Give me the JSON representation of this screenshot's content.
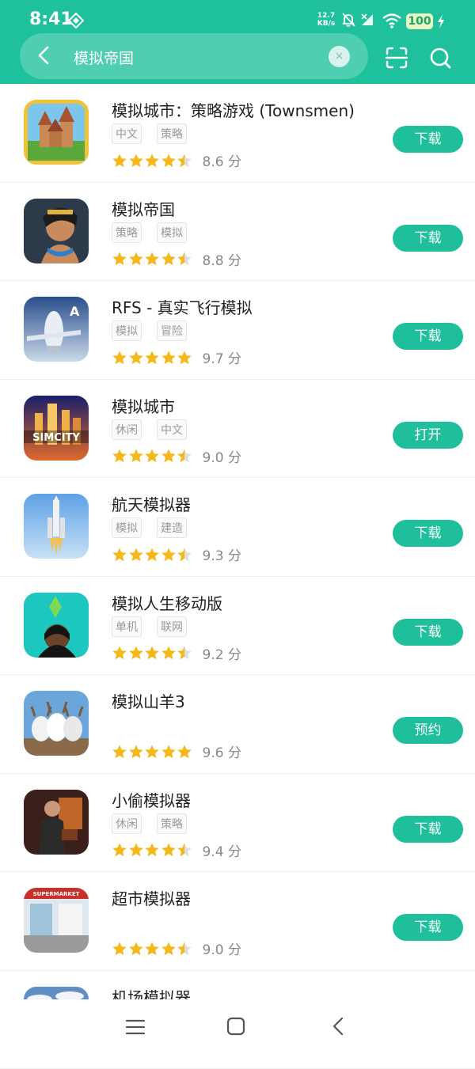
{
  "status_bar": {
    "time": "8:41",
    "speed_value": "12.7",
    "speed_unit": "KB/s",
    "battery": "100"
  },
  "search": {
    "query": "模拟帝国",
    "clear_label": "×"
  },
  "apps": [
    {
      "title": "模拟城市：策略游戏 (Townsmen)",
      "tags": [
        "中文",
        "策略"
      ],
      "rating": 4.5,
      "score": "8.6 分",
      "action": "下载",
      "icon": "townsmen-icon"
    },
    {
      "title": "模拟帝国",
      "tags": [
        "策略",
        "模拟"
      ],
      "rating": 4.5,
      "score": "8.8 分",
      "action": "下载",
      "icon": "empire-icon"
    },
    {
      "title": "RFS - 真实飞行模拟",
      "tags": [
        "模拟",
        "冒险"
      ],
      "rating": 5,
      "score": "9.7 分",
      "action": "下载",
      "icon": "rfs-icon"
    },
    {
      "title": "模拟城市",
      "tags": [
        "休闲",
        "中文"
      ],
      "rating": 4.5,
      "score": "9.0 分",
      "action": "打开",
      "icon": "simcity-icon"
    },
    {
      "title": "航天模拟器",
      "tags": [
        "模拟",
        "建造"
      ],
      "rating": 4.5,
      "score": "9.3 分",
      "action": "下载",
      "icon": "spaceflight-icon"
    },
    {
      "title": "模拟人生移动版",
      "tags": [
        "单机",
        "联网"
      ],
      "rating": 4.5,
      "score": "9.2 分",
      "action": "下载",
      "icon": "sims-icon"
    },
    {
      "title": "模拟山羊3",
      "tags": [],
      "rating": 5,
      "score": "9.6 分",
      "action": "预约",
      "icon": "goat-icon"
    },
    {
      "title": "小偷模拟器",
      "tags": [
        "休闲",
        "策略"
      ],
      "rating": 4.5,
      "score": "9.4 分",
      "action": "下载",
      "icon": "thief-icon"
    },
    {
      "title": "超市模拟器",
      "tags": [],
      "rating": 4.5,
      "score": "9.0 分",
      "action": "下载",
      "icon": "supermarket-icon"
    },
    {
      "title": "机场模拟器",
      "tags": [],
      "rating": 0,
      "score": "",
      "action": "",
      "icon": "airport-icon"
    }
  ],
  "supermarket_sign": "SUPERMARKET",
  "simcity_logo": "SIMCITY",
  "colors": {
    "accent": "#1fc19c",
    "button": "#1fbf9b",
    "star": "#f5b81b"
  }
}
